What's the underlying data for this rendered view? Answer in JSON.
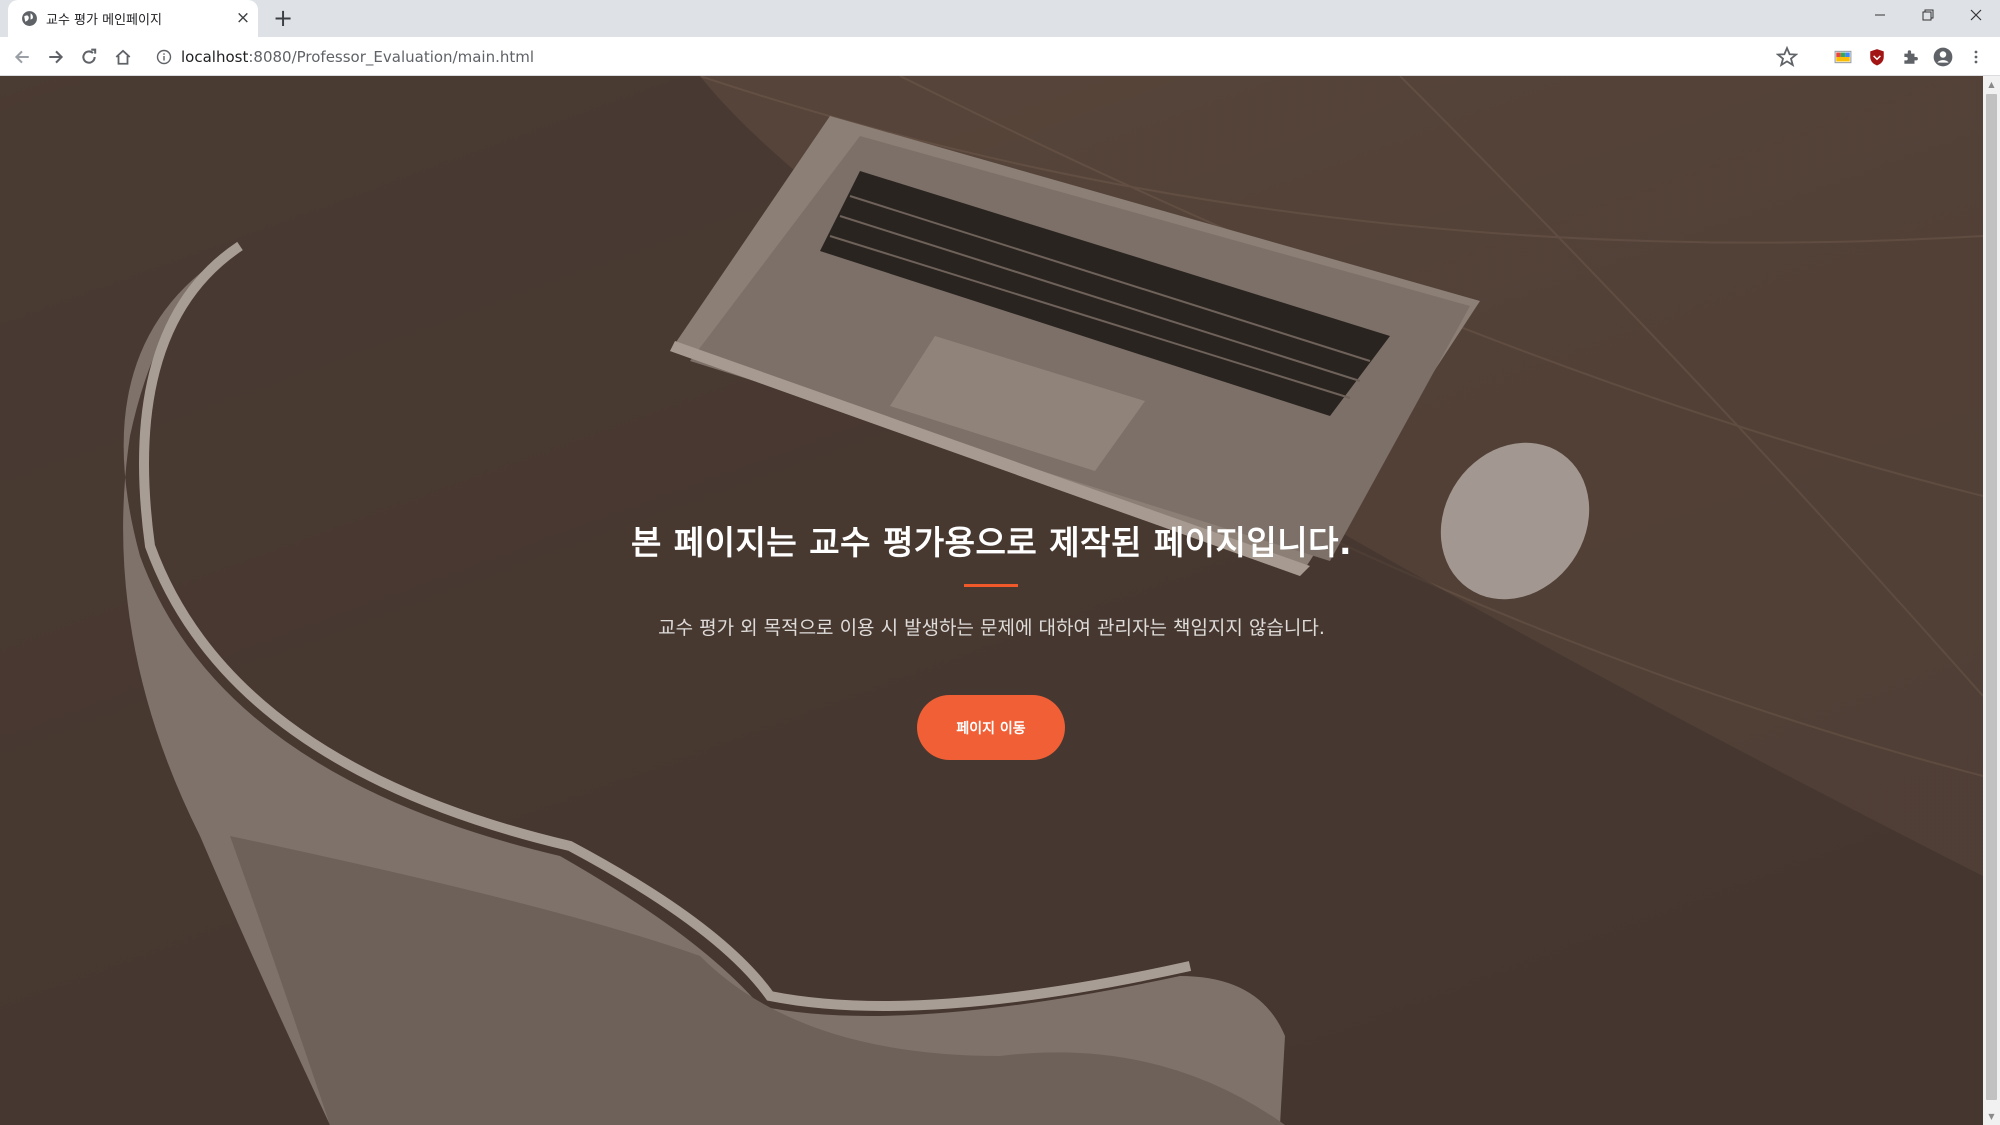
{
  "browser": {
    "tab_title": "교수 평가 메인페이지",
    "tab_close_glyph": "×",
    "newtab_glyph": "+",
    "url_host": "localhost",
    "url_path": ":8080/Professor_Evaluation/main.html"
  },
  "hero": {
    "title": "본 페이지는 교수 평가용으로 제작된 페이지입니다.",
    "subtitle": "교수 평가 외 목적으로 이용 시 발생하는 문제에 대하여 관리자는 책임지지 않습니다.",
    "button_label": "페이지 이동"
  },
  "colors": {
    "accent": "#f05f35",
    "overlay": "#4d3f36"
  },
  "icons": {
    "favicon": "globe-icon",
    "back": "arrow-left-icon",
    "forward": "arrow-right-icon",
    "reload": "reload-icon",
    "home": "home-icon",
    "info": "info-icon",
    "bookmark": "star-icon",
    "extensions": [
      "color-picker-icon",
      "shield-icon",
      "puzzle-icon"
    ],
    "profile": "account-icon",
    "menu": "more-vert-icon"
  }
}
